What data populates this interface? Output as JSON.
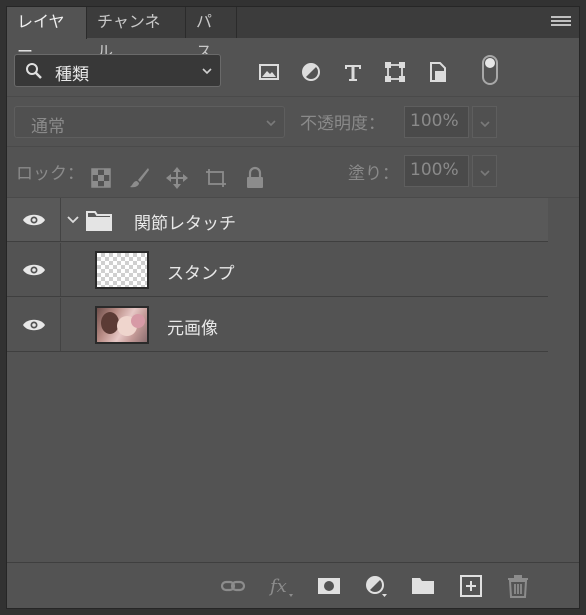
{
  "tabs": [
    {
      "label": "レイヤー",
      "active": true
    },
    {
      "label": "チャンネル",
      "active": false
    },
    {
      "label": "パス",
      "active": false
    }
  ],
  "filter": {
    "kind_label": "種類",
    "icons": [
      "image-filter-icon",
      "adjustment-filter-icon",
      "type-filter-icon",
      "shape-filter-icon",
      "smart-object-filter-icon"
    ]
  },
  "blend": {
    "mode": "通常",
    "opacity_label": "不透明度：",
    "opacity_value": "100%"
  },
  "lock": {
    "label": "ロック：",
    "fill_label": "塗り：",
    "fill_value": "100%"
  },
  "layers": [
    {
      "name": "関節レタッチ",
      "type": "group",
      "visible": true
    },
    {
      "name": "スタンプ",
      "type": "transparent",
      "visible": true
    },
    {
      "name": "元画像",
      "type": "photo",
      "visible": true
    }
  ],
  "colors": {
    "panel_bg": "#535353",
    "tab_bar_bg": "#3c3c3c",
    "app_bg": "#323232"
  }
}
